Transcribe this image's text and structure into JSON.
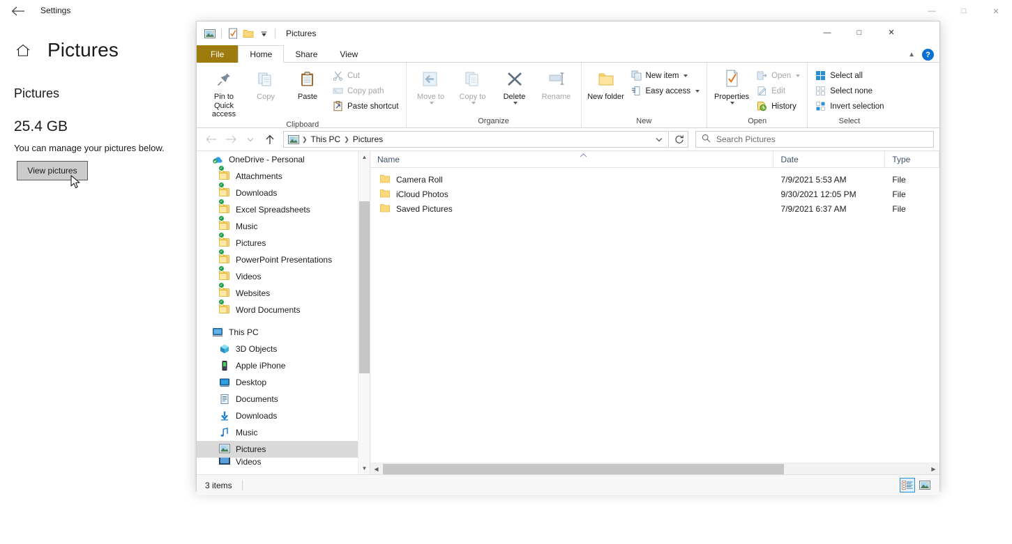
{
  "settings": {
    "titlebar_title": "Settings",
    "back_icon": "back-arrow-icon",
    "home_icon": "home-icon",
    "page_title": "Pictures",
    "section_title": "Pictures",
    "size_value": "25.4 GB",
    "description": "You can manage your pictures below.",
    "button_label": "View pictures",
    "window_controls": {
      "minimize": "—",
      "maximize": "□",
      "close": "✕"
    }
  },
  "explorer": {
    "title": "Pictures",
    "quick_access_toolbar": [
      {
        "name": "pictures-library-icon",
        "label": ""
      },
      {
        "name": "properties-check-icon",
        "label": ""
      },
      {
        "name": "new-folder-icon",
        "label": ""
      },
      {
        "name": "customize-qat-caret",
        "label": "☷"
      }
    ],
    "window_controls": {
      "minimize": "—",
      "maximize": "□",
      "close": "✕"
    },
    "ribbon_collapse_icon": "chevron-up-icon",
    "help_label": "?",
    "tabs": [
      {
        "label": "File",
        "type": "file"
      },
      {
        "label": "Home",
        "type": "active"
      },
      {
        "label": "Share",
        "type": "normal"
      },
      {
        "label": "View",
        "type": "normal"
      }
    ],
    "ribbon_groups": [
      {
        "label": "Clipboard",
        "big_buttons": [
          {
            "label": "Pin to Quick access",
            "icon": "pin-icon",
            "disabled": false
          },
          {
            "label": "Copy",
            "icon": "copy-icon",
            "disabled": true
          },
          {
            "label": "Paste",
            "icon": "paste-icon",
            "disabled": false
          }
        ],
        "small_buttons": [
          {
            "label": "Cut",
            "icon": "scissors-icon",
            "disabled": true
          },
          {
            "label": "Copy path",
            "icon": "copy-path-icon",
            "disabled": true
          },
          {
            "label": "Paste shortcut",
            "icon": "paste-shortcut-icon",
            "disabled": false
          }
        ]
      },
      {
        "label": "Organize",
        "big_buttons": [
          {
            "label": "Move to",
            "icon": "move-to-icon",
            "disabled": true,
            "caret": true
          },
          {
            "label": "Copy to",
            "icon": "copy-to-icon",
            "disabled": true,
            "caret": true
          },
          {
            "label": "Delete",
            "icon": "delete-x-icon",
            "disabled": false,
            "caret": true
          },
          {
            "label": "Rename",
            "icon": "rename-icon",
            "disabled": true
          }
        ],
        "small_buttons": []
      },
      {
        "label": "New",
        "big_buttons": [
          {
            "label": "New folder",
            "icon": "new-folder-icon",
            "disabled": false
          }
        ],
        "small_buttons": [
          {
            "label": "New item",
            "icon": "new-item-icon",
            "disabled": false,
            "caret": true
          },
          {
            "label": "Easy access",
            "icon": "easy-access-icon",
            "disabled": false,
            "caret": true
          }
        ]
      },
      {
        "label": "Open",
        "big_buttons": [
          {
            "label": "Properties",
            "icon": "properties-icon",
            "disabled": false,
            "caret": true
          }
        ],
        "small_buttons": [
          {
            "label": "Open",
            "icon": "open-icon",
            "disabled": true,
            "caret": true
          },
          {
            "label": "Edit",
            "icon": "edit-icon",
            "disabled": true
          },
          {
            "label": "History",
            "icon": "history-icon",
            "disabled": false
          }
        ]
      },
      {
        "label": "Select",
        "big_buttons": [],
        "small_buttons": [
          {
            "label": "Select all",
            "icon": "select-all-icon",
            "disabled": false
          },
          {
            "label": "Select none",
            "icon": "select-none-icon",
            "disabled": false
          },
          {
            "label": "Invert selection",
            "icon": "invert-selection-icon",
            "disabled": false
          }
        ]
      }
    ],
    "address_bar": {
      "back_icon": "back-arrow-icon",
      "forward_icon": "forward-arrow-icon",
      "recent_icon": "chevron-down-icon",
      "up_icon": "up-arrow-icon",
      "breadcrumb_icon": "pictures-library-icon",
      "breadcrumbs": [
        "This PC",
        "Pictures"
      ],
      "dropdown_icon": "chevron-down-icon",
      "refresh_icon": "refresh-icon",
      "search_icon": "search-icon",
      "search_placeholder": "Search Pictures",
      "search_value": ""
    },
    "nav_pane": [
      {
        "label": "OneDrive - Personal",
        "icon": "onedrive-cloud-icon",
        "level": "root",
        "selected": false
      },
      {
        "label": "Attachments",
        "icon": "folder-synced-icon",
        "level": "child",
        "selected": false
      },
      {
        "label": "Downloads",
        "icon": "folder-synced-icon",
        "level": "child",
        "selected": false
      },
      {
        "label": "Excel Spreadsheets",
        "icon": "folder-synced-icon",
        "level": "child",
        "selected": false
      },
      {
        "label": "Music",
        "icon": "folder-synced-shared-icon",
        "level": "child",
        "selected": false
      },
      {
        "label": "Pictures",
        "icon": "folder-synced-icon",
        "level": "child",
        "selected": false
      },
      {
        "label": "PowerPoint Presentations",
        "icon": "folder-synced-icon",
        "level": "child",
        "selected": false
      },
      {
        "label": "Videos",
        "icon": "folder-synced-icon",
        "level": "child",
        "selected": false
      },
      {
        "label": "Websites",
        "icon": "folder-synced-icon",
        "level": "child",
        "selected": false
      },
      {
        "label": "Word Documents",
        "icon": "folder-synced-icon",
        "level": "child",
        "selected": false
      },
      {
        "label": "",
        "icon": "spacer",
        "level": "spacer",
        "selected": false
      },
      {
        "label": "This PC",
        "icon": "this-pc-icon",
        "level": "root",
        "selected": false
      },
      {
        "label": "3D Objects",
        "icon": "3d-objects-icon",
        "level": "child",
        "selected": false
      },
      {
        "label": "Apple iPhone",
        "icon": "phone-icon",
        "level": "child",
        "selected": false
      },
      {
        "label": "Desktop",
        "icon": "desktop-icon",
        "level": "child",
        "selected": false
      },
      {
        "label": "Documents",
        "icon": "documents-icon",
        "level": "child",
        "selected": false
      },
      {
        "label": "Downloads",
        "icon": "downloads-arrow-icon",
        "level": "child",
        "selected": false
      },
      {
        "label": "Music",
        "icon": "music-note-icon",
        "level": "child",
        "selected": false
      },
      {
        "label": "Pictures",
        "icon": "pictures-icon",
        "level": "child",
        "selected": true
      },
      {
        "label": "Videos",
        "icon": "videos-icon",
        "level": "child",
        "selected": false
      }
    ],
    "columns": [
      {
        "label": "Name",
        "sorted": true,
        "sort_direction": "asc"
      },
      {
        "label": "Date",
        "sorted": false
      },
      {
        "label": "Type",
        "sorted": false
      }
    ],
    "files": [
      {
        "name": "Camera Roll",
        "date": "7/9/2021 5:53 AM",
        "type": "File",
        "icon": "folder-icon"
      },
      {
        "name": "iCloud Photos",
        "date": "9/30/2021 12:05 PM",
        "type": "File",
        "icon": "folder-icon"
      },
      {
        "name": "Saved Pictures",
        "date": "7/9/2021 6:37 AM",
        "type": "File",
        "icon": "folder-icon"
      }
    ],
    "status": {
      "item_count": "3 items",
      "view_buttons": [
        {
          "name": "details-view-button",
          "active": true
        },
        {
          "name": "large-icons-view-button",
          "active": false
        }
      ]
    }
  },
  "colors": {
    "file_tab": "#9d7c0d",
    "accent_blue": "#0b6fd4",
    "selection_gray": "#d9d9d9",
    "view_active_border": "#2a8fd4",
    "folder_yellow": "#fbd97a",
    "sync_green": "#1d9b4a",
    "column_header_text": "#40526b"
  }
}
